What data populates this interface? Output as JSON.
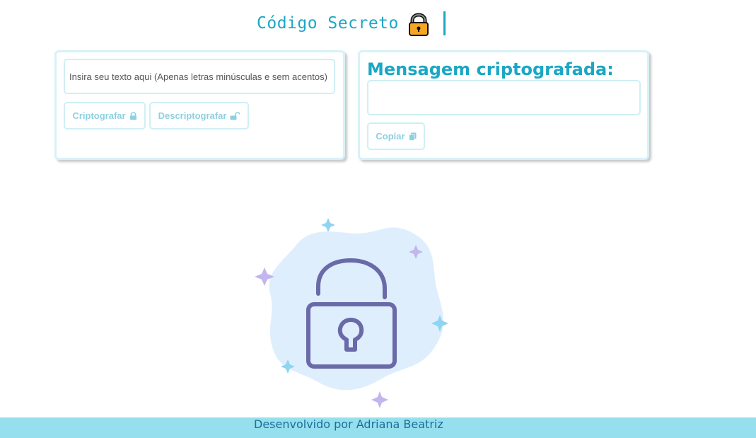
{
  "header": {
    "title": "Código Secreto",
    "icon": "padlock-icon",
    "accent_color": "#1ba7c4"
  },
  "input_panel": {
    "placeholder": "Insira seu texto aqui (Apenas letras minúsculas e sem acentos)",
    "value": "",
    "encrypt_label": "Criptografar",
    "encrypt_icon": "lock-icon",
    "decrypt_label": "Descriptografar",
    "decrypt_icon": "unlock-icon"
  },
  "output_panel": {
    "title": "Mensagem criptografada:",
    "value": "",
    "copy_label": "Copiar",
    "copy_icon": "copy-icon"
  },
  "illustration": {
    "icon": "open-padlock-icon",
    "blob_color": "#deeefd",
    "padlock_color": "#6a6aa8"
  },
  "footer": {
    "text": "Desenvolvido por Adriana Beatriz",
    "background": "#95dfee"
  }
}
